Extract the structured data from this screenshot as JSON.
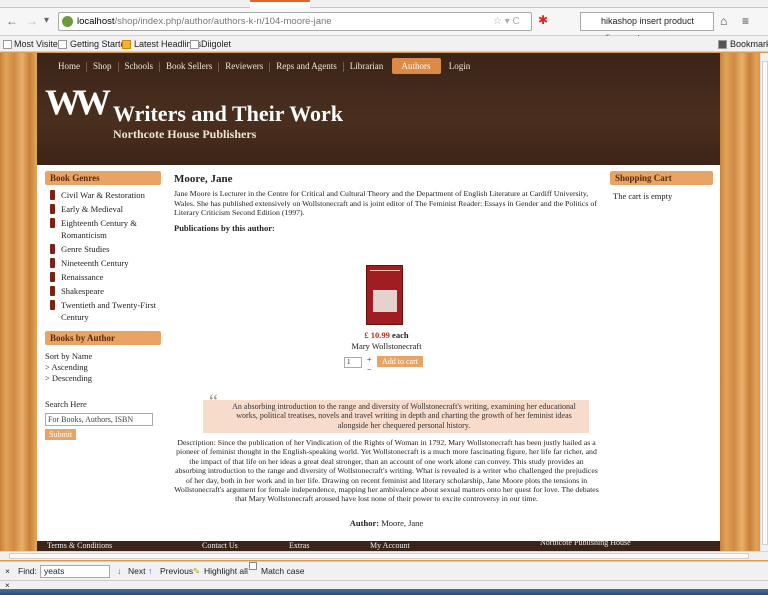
{
  "browser": {
    "url_host": "localhost",
    "url_path": "/shop/index.php/author/authors-k-n/104-moore-jane",
    "search_text": "hikashop insert product alignment"
  },
  "bookmarks": {
    "items": [
      "Most Visited",
      "Getting Started",
      "Latest Headlines",
      "Diigolet"
    ],
    "right": "Bookmarks"
  },
  "site": {
    "nav": [
      "Home",
      "Shop",
      "Schools",
      "Book Sellers",
      "Reviewers",
      "Reps and Agents",
      "Librarian",
      "Authors",
      "Login"
    ],
    "active_nav": "Authors",
    "logo": "WW",
    "title": "Writers and Their Work",
    "subtitle": "Northcote House Publishers"
  },
  "sidebar": {
    "genres_title": "Book Genres",
    "genres": [
      "Civil War & Restoration",
      "Early & Medieval",
      "Eighteenth Century & Romanticism",
      "Genre Studies",
      "Nineteenth Century",
      "Renaissance",
      "Shakespeare",
      "Twentieth and Twenty-First Century"
    ],
    "by_author_title": "Books by Author",
    "sort_label": "Sort by Name",
    "ascending": "> Ascending",
    "descending": "> Descending",
    "search_label": "Search Here",
    "search_placeholder": "For Books, Authors, ISBN",
    "submit": "Submit"
  },
  "author": {
    "name": "Moore, Jane",
    "bio": "Jane Moore is Lecturer in the Centre for Critical and Cultural Theory and the Department of English Literature at Cardiff University, Wales. She has published extensively on Wollstonecraft and is joint editor of The Feminist Reader: Essays in Gender and the Politics of Literary Criticism Second Edition (1997).",
    "pubs_heading": "Publications by this author:"
  },
  "product": {
    "price": "£ 10.99",
    "price_suffix": " each",
    "title": "Mary Wollstonecraft",
    "qty": "1",
    "plus": "+",
    "minus": "−",
    "add_to_cart": "Add to cart",
    "quote": "An absorbing introduction to the range and diversity of Wollstonecraft's writing, examining her educational works, political treatises, novels and travel writing in depth and charting the growth of her feminist ideas alongside her chequered personal history.",
    "description": "Description: Since the publication of her Vindication of the Rights of Woman in 1792, Mary Wollstonecraft has been justly hailed as a pioneer of feminist thought in the English-speaking world. Yet Wollstonecraft is a much more fascinating figure, her life far richer, and the impact of that life on her ideas a great deal stronger, than an account of one work alone can convey. This study provides an absorbing introduction to the range and diversity of Wollstonecraft's writing. What is revealed is a writer who challenged the prejudices of her day, both in her work and in her life. Drawing on recent feminist and literary scholarship, Jane Moore plots the tensions in Wollstonecraft's argument for female independence, mapping her ambivalence about sexual matters onto her quest for love. The debates that Mary Wollstonecraft aroused have lost none of their power to excite controversy in our time.",
    "author_label": "Author:",
    "author_value": " Moore, Jane"
  },
  "cart": {
    "title": "Shopping Cart",
    "empty": "The cart is empty"
  },
  "footer": {
    "items": [
      "Terms & Conditions",
      "Contact Us",
      "Extras",
      "My Account",
      "Northcote Publishing House"
    ]
  },
  "findbar": {
    "label": "Find:",
    "value": "yeats",
    "next": "Next",
    "previous": "Previous",
    "highlight": "Highlight all",
    "match_case": "Match case"
  }
}
